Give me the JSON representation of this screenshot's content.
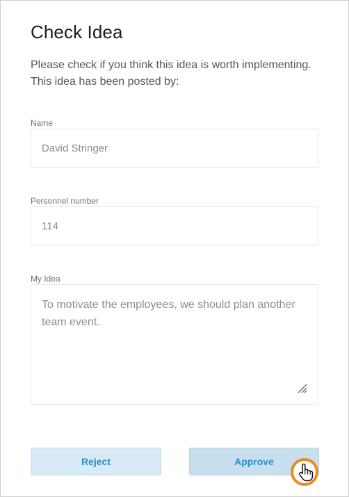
{
  "dialog": {
    "title": "Check Idea",
    "intro_line1": "Please check if you think this idea is worth implementing.",
    "intro_line2": "This idea has been posted by:"
  },
  "fields": {
    "name": {
      "label": "Name",
      "value": "David Stringer"
    },
    "personnel_number": {
      "label": "Personnel number",
      "value": "114"
    },
    "idea": {
      "label": "My Idea",
      "value_line1": "To motivate the employees, we should plan another",
      "value_line2": "team event."
    }
  },
  "actions": {
    "reject_label": "Reject",
    "approve_label": "Approve"
  },
  "icons": {
    "resize": "resize-handle-icon",
    "cursor": "hand-pointer-icon"
  },
  "colors": {
    "button_text": "#2d8ec4",
    "reject_bg": "#d7eaf6",
    "approve_bg": "#c8dfed",
    "cursor_ring": "#ef8a17"
  }
}
